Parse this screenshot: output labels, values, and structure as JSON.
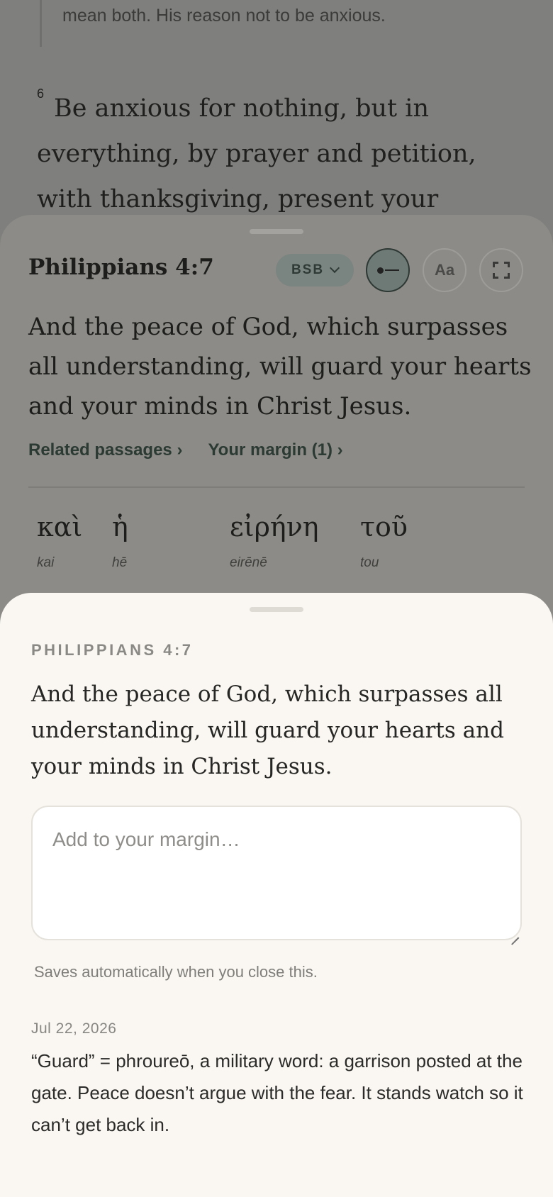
{
  "reader": {
    "quote_line": "mean both. His reason not to be anxious.",
    "verse_number": "6",
    "verse_text": "Be anxious for nothing, but in everything, by prayer and petition, with thanksgiving, present your"
  },
  "detail_sheet": {
    "title": "Philippians 4:7",
    "translation": "BSB",
    "font_button": "Aa",
    "verse_text": "And the peace of God, which surpasses all understanding, will guard your hearts and your minds in Christ Jesus.",
    "links": {
      "related": "Related passages ›",
      "margin": "Your margin (1) ›"
    },
    "greek_words": [
      {
        "greek": "καὶ",
        "translit": "kai"
      },
      {
        "greek": "ἡ",
        "translit": "hē"
      },
      {
        "greek": "εἰρήνη",
        "translit": "eirēnē"
      },
      {
        "greek": "τοῦ",
        "translit": "tou"
      }
    ]
  },
  "margin_sheet": {
    "reference": "PHILIPPIANS 4:7",
    "verse_text": "And the peace of God, which surpasses all understanding, will guard your hearts and your minds in Christ Jesus.",
    "input_placeholder": "Add to your margin…",
    "input_value": "",
    "autosave_hint": "Saves automatically when you close this.",
    "notes": [
      {
        "date": "Jul 22, 2026",
        "text": "“Guard” = phroureō, a military word: a garrison posted at the gate. Peace doesn’t argue with the fear. It stands watch so it can’t get back in."
      }
    ]
  }
}
